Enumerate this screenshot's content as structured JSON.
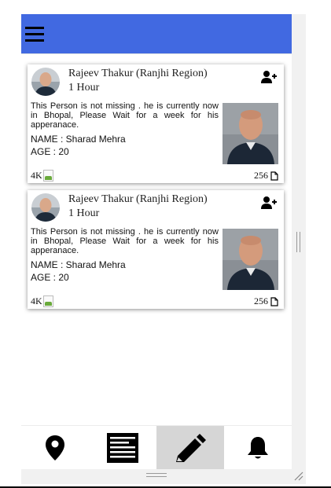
{
  "header": {
    "menu_icon": "hamburger-menu-icon",
    "color": "#4169e1"
  },
  "posts": [
    {
      "author": "Rajeev Thakur (Ranjhi Region)",
      "time": "1 Hour",
      "description": "This Person is not missing . he is currently now in Bhopal, Please Wait for a week for his apperanace.",
      "name_line": "NAME : Sharad Mehra",
      "age_line": "AGE : 20",
      "likes": "4K",
      "views": "256"
    },
    {
      "author": "Rajeev Thakur (Ranjhi Region)",
      "time": "1 Hour",
      "description": "This Person is not missing . he is currently now in Bhopal, Please Wait for a week for his apperanace.",
      "name_line": "NAME : Sharad Mehra",
      "age_line": "AGE : 20",
      "likes": "4K",
      "views": "256"
    }
  ],
  "bottom_nav": [
    {
      "icon": "location-pin-icon",
      "active": false
    },
    {
      "icon": "news-feed-icon",
      "active": false
    },
    {
      "icon": "pencil-edit-icon",
      "active": true
    },
    {
      "icon": "bell-notification-icon",
      "active": false
    }
  ]
}
